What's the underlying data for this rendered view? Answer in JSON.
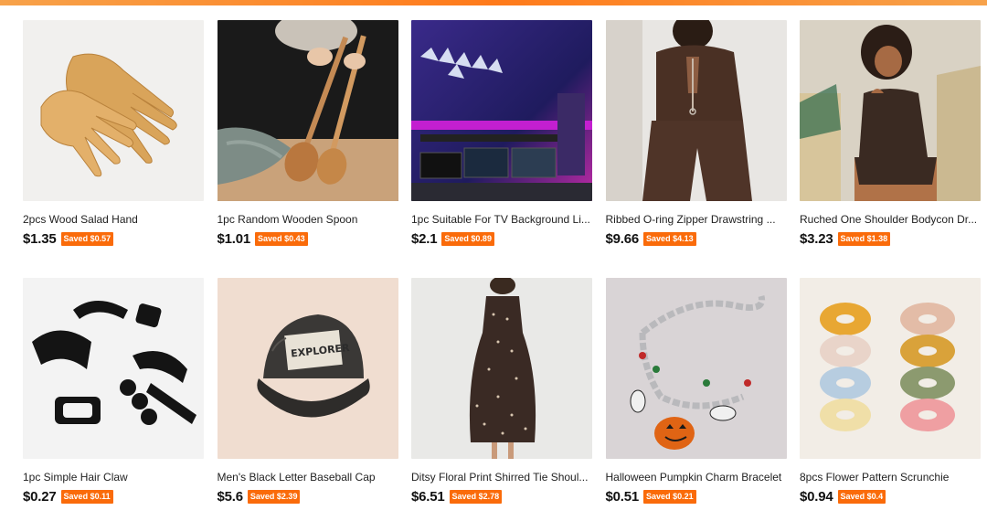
{
  "products": [
    {
      "title": "2pcs Wood Salad Hand",
      "price": "$1.35",
      "saved": "Saved $0.57",
      "image_icon": "wooden-salad-hands-image"
    },
    {
      "title": "1pc Random Wooden Spoon",
      "price": "$1.01",
      "saved": "Saved $0.43",
      "image_icon": "wooden-spoon-image"
    },
    {
      "title": "1pc Suitable For TV Background Li...",
      "price": "$2.1",
      "saved": "Saved $0.89",
      "image_icon": "led-gaming-room-image"
    },
    {
      "title": "Ribbed O-ring Zipper Drawstring ...",
      "price": "$9.66",
      "saved": "Saved $4.13",
      "image_icon": "brown-ribbed-set-image"
    },
    {
      "title": "Ruched One Shoulder Bodycon Dr...",
      "price": "$3.23",
      "saved": "Saved $1.38",
      "image_icon": "brown-bodycon-dress-image"
    },
    {
      "title": "1pc Simple Hair Claw",
      "price": "$0.27",
      "saved": "Saved $0.11",
      "image_icon": "black-hair-claws-image"
    },
    {
      "title": "Men's Black Letter Baseball Cap",
      "price": "$5.6",
      "saved": "Saved $2.39",
      "image_icon": "explorer-baseball-cap-image"
    },
    {
      "title": "Ditsy Floral Print Shirred Tie Shoul...",
      "price": "$6.51",
      "saved": "Saved $2.78",
      "image_icon": "floral-dress-image"
    },
    {
      "title": "Halloween Pumpkin Charm Bracelet",
      "price": "$0.51",
      "saved": "Saved $0.21",
      "image_icon": "pumpkin-bracelet-image"
    },
    {
      "title": "8pcs Flower Pattern Scrunchie",
      "price": "$0.94",
      "saved": "Saved $0.4",
      "image_icon": "flower-scrunchies-image"
    }
  ],
  "colors": {
    "accent": "#fa6b0a",
    "top_bar": "#ff7a1a"
  },
  "image_text": {
    "cap_patch": "EXPLORER"
  }
}
